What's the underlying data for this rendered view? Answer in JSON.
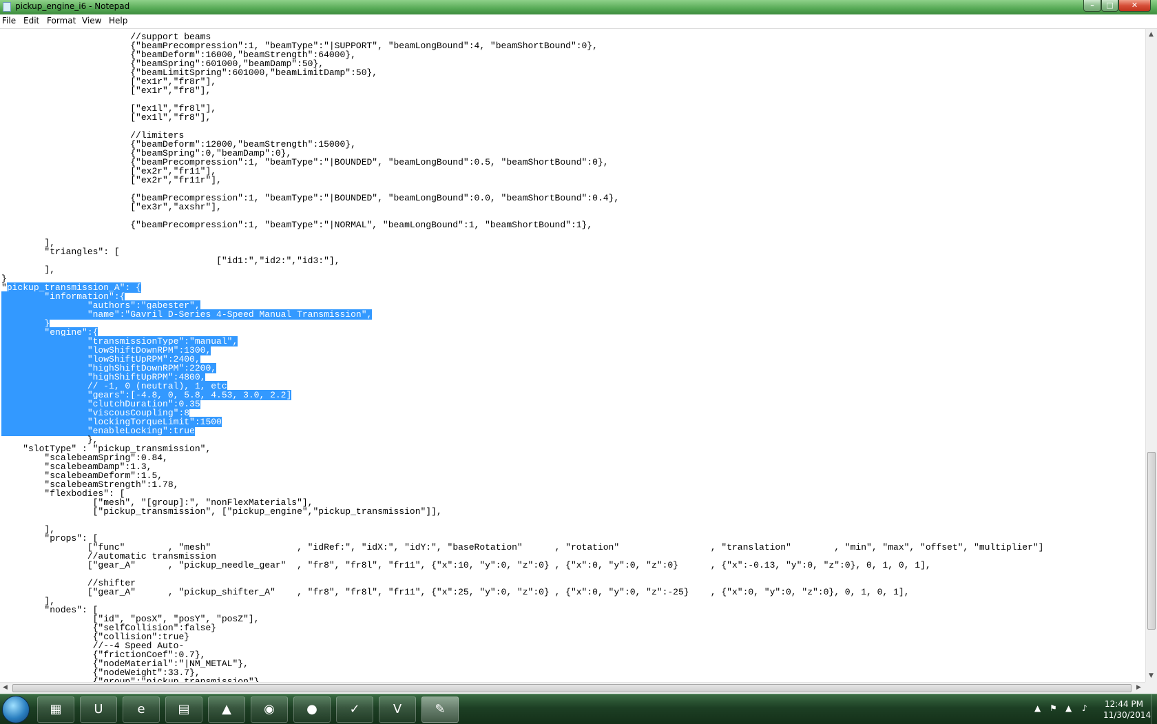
{
  "window": {
    "title": "pickup_engine_i6 - Notepad",
    "min_glyph": "–",
    "max_glyph": "□",
    "close_glyph": "✕"
  },
  "menu": [
    "File",
    "Edit",
    "Format",
    "View",
    "Help"
  ],
  "editor": {
    "lines": [
      {
        "pre": "\t\t\t//support beams",
        "sel": "",
        "post": ""
      },
      {
        "pre": "\t\t\t{\"beamPrecompression\":1, \"beamType\":\"|SUPPORT\", \"beamLongBound\":4, \"beamShortBound\":0},",
        "sel": "",
        "post": ""
      },
      {
        "pre": "\t\t\t{\"beamDeform\":16000,\"beamStrength\":64000},",
        "sel": "",
        "post": ""
      },
      {
        "pre": "\t\t\t{\"beamSpring\":601000,\"beamDamp\":50},",
        "sel": "",
        "post": ""
      },
      {
        "pre": "\t\t\t{\"beamLimitSpring\":601000,\"beamLimitDamp\":50},",
        "sel": "",
        "post": ""
      },
      {
        "pre": "\t\t\t[\"ex1r\",\"fr8r\"],",
        "sel": "",
        "post": ""
      },
      {
        "pre": "\t\t\t[\"ex1r\",\"fr8\"],",
        "sel": "",
        "post": ""
      },
      {
        "pre": "",
        "sel": "",
        "post": ""
      },
      {
        "pre": "\t\t\t[\"ex1l\",\"fr8l\"],",
        "sel": "",
        "post": ""
      },
      {
        "pre": "\t\t\t[\"ex1l\",\"fr8\"],",
        "sel": "",
        "post": ""
      },
      {
        "pre": "",
        "sel": "",
        "post": ""
      },
      {
        "pre": "\t\t\t//limiters",
        "sel": "",
        "post": ""
      },
      {
        "pre": "\t\t\t{\"beamDeform\":12000,\"beamStrength\":15000},",
        "sel": "",
        "post": ""
      },
      {
        "pre": "\t\t\t{\"beamSpring\":0,\"beamDamp\":0},",
        "sel": "",
        "post": ""
      },
      {
        "pre": "\t\t\t{\"beamPrecompression\":1, \"beamType\":\"|BOUNDED\", \"beamLongBound\":0.5, \"beamShortBound\":0},",
        "sel": "",
        "post": ""
      },
      {
        "pre": "\t\t\t[\"ex2r\",\"fr11\"],",
        "sel": "",
        "post": ""
      },
      {
        "pre": "\t\t\t[\"ex2r\",\"fr11r\"],",
        "sel": "",
        "post": ""
      },
      {
        "pre": "",
        "sel": "",
        "post": ""
      },
      {
        "pre": "\t\t\t{\"beamPrecompression\":1, \"beamType\":\"|BOUNDED\", \"beamLongBound\":0.0, \"beamShortBound\":0.4},",
        "sel": "",
        "post": ""
      },
      {
        "pre": "\t\t\t[\"ex3r\",\"axshr\"],",
        "sel": "",
        "post": ""
      },
      {
        "pre": "",
        "sel": "",
        "post": ""
      },
      {
        "pre": "\t\t\t{\"beamPrecompression\":1, \"beamType\":\"|NORMAL\", \"beamLongBound\":1, \"beamShortBound\":1},",
        "sel": "",
        "post": ""
      },
      {
        "pre": "",
        "sel": "",
        "post": ""
      },
      {
        "pre": "\t],",
        "sel": "",
        "post": ""
      },
      {
        "pre": "\t\"triangles\": [",
        "sel": "",
        "post": ""
      },
      {
        "pre": "\t\t\t\t\t[\"id1:\",\"id2:\",\"id3:\"],",
        "sel": "",
        "post": ""
      },
      {
        "pre": "\t],",
        "sel": "",
        "post": ""
      },
      {
        "pre": "}",
        "sel": "",
        "post": ""
      },
      {
        "pre": "\"",
        "sel": "pickup_transmission_A\": {",
        "post": ""
      },
      {
        "pre": "",
        "sel": "\t\"information\":{",
        "post": ""
      },
      {
        "pre": "",
        "sel": "\t\t\"authors\":\"gabester\",",
        "post": ""
      },
      {
        "pre": "",
        "sel": "\t\t\"name\":\"Gavril D-Series 4-Speed Manual Transmission\",",
        "post": ""
      },
      {
        "pre": "",
        "sel": "\t}",
        "post": ""
      },
      {
        "pre": "",
        "sel": "\t\"engine\":{",
        "post": ""
      },
      {
        "pre": "",
        "sel": "\t\t\"transmissionType\":\"manual\",",
        "post": ""
      },
      {
        "pre": "",
        "sel": "\t\t\"lowShiftDownRPM\":1300,",
        "post": ""
      },
      {
        "pre": "",
        "sel": "\t\t\"lowShiftUpRPM\":2400,",
        "post": ""
      },
      {
        "pre": "",
        "sel": "\t\t\"highShiftDownRPM\":2200,",
        "post": ""
      },
      {
        "pre": "",
        "sel": "\t\t\"highShiftUpRPM\":4800,",
        "post": ""
      },
      {
        "pre": "",
        "sel": "\t\t// -1, 0 (neutral), 1, etc",
        "post": ""
      },
      {
        "pre": "",
        "sel": "\t\t\"gears\":[-4.8, 0, 5.8, 4.53, 3.0, 2.2]",
        "post": ""
      },
      {
        "pre": "",
        "sel": "\t\t\"clutchDuration\":0.35",
        "post": ""
      },
      {
        "pre": "",
        "sel": "\t\t\"viscousCoupling\":8",
        "post": ""
      },
      {
        "pre": "",
        "sel": "\t\t\"lockingTorqueLimit\":1500",
        "post": ""
      },
      {
        "pre": "",
        "sel": "\t\t\"enableLocking\":true",
        "post": ""
      },
      {
        "pre": "\t\t},",
        "sel": "",
        "post": ""
      },
      {
        "pre": "    \"slotType\" : \"pickup_transmission\",",
        "sel": "",
        "post": ""
      },
      {
        "pre": "\t\"scalebeamSpring\":0.84,",
        "sel": "",
        "post": ""
      },
      {
        "pre": "\t\"scalebeamDamp\":1.3,",
        "sel": "",
        "post": ""
      },
      {
        "pre": "\t\"scalebeamDeform\":1.5,",
        "sel": "",
        "post": ""
      },
      {
        "pre": "\t\"scalebeamStrength\":1.78,",
        "sel": "",
        "post": ""
      },
      {
        "pre": "\t\"flexbodies\": [",
        "sel": "",
        "post": ""
      },
      {
        "pre": "\t\t [\"mesh\", \"[group]:\", \"nonFlexMaterials\"],",
        "sel": "",
        "post": ""
      },
      {
        "pre": "\t\t [\"pickup_transmission\", [\"pickup_engine\",\"pickup_transmission\"]],",
        "sel": "",
        "post": ""
      },
      {
        "pre": "",
        "sel": "",
        "post": ""
      },
      {
        "pre": "\t],",
        "sel": "",
        "post": ""
      },
      {
        "pre": "\t\"props\": [",
        "sel": "",
        "post": ""
      },
      {
        "pre": "\t\t[\"func\"        , \"mesh\"                , \"idRef:\", \"idX:\", \"idY:\", \"baseRotation\"      , \"rotation\"                 , \"translation\"        , \"min\", \"max\", \"offset\", \"multiplier\"]",
        "sel": "",
        "post": ""
      },
      {
        "pre": "\t\t//automatic transmission",
        "sel": "",
        "post": ""
      },
      {
        "pre": "\t\t[\"gear_A\"      , \"pickup_needle_gear\"  , \"fr8\", \"fr8l\", \"fr11\", {\"x\":10, \"y\":0, \"z\":0} , {\"x\":0, \"y\":0, \"z\":0}      , {\"x\":-0.13, \"y\":0, \"z\":0}, 0, 1, 0, 1],",
        "sel": "",
        "post": ""
      },
      {
        "pre": "",
        "sel": "",
        "post": ""
      },
      {
        "pre": "\t\t//shifter",
        "sel": "",
        "post": ""
      },
      {
        "pre": "\t\t[\"gear_A\"      , \"pickup_shifter_A\"    , \"fr8\", \"fr8l\", \"fr11\", {\"x\":25, \"y\":0, \"z\":0} , {\"x\":0, \"y\":0, \"z\":-25}    , {\"x\":0, \"y\":0, \"z\":0}, 0, 1, 0, 1],",
        "sel": "",
        "post": ""
      },
      {
        "pre": "\t],",
        "sel": "",
        "post": ""
      },
      {
        "pre": "\t\"nodes\": [",
        "sel": "",
        "post": ""
      },
      {
        "pre": "\t\t [\"id\", \"posX\", \"posY\", \"posZ\"],",
        "sel": "",
        "post": ""
      },
      {
        "pre": "\t\t {\"selfCollision\":false}",
        "sel": "",
        "post": ""
      },
      {
        "pre": "\t\t {\"collision\":true}",
        "sel": "",
        "post": ""
      },
      {
        "pre": "\t\t //--4 Speed Auto-",
        "sel": "",
        "post": ""
      },
      {
        "pre": "\t\t {\"frictionCoef\":0.7},",
        "sel": "",
        "post": ""
      },
      {
        "pre": "\t\t {\"nodeMaterial\":\"|NM_METAL\"},",
        "sel": "",
        "post": ""
      },
      {
        "pre": "\t\t {\"nodeWeight\":33.7},",
        "sel": "",
        "post": ""
      },
      {
        "pre": "\t\t {\"group\":\"pickup_transmission\"},",
        "sel": "",
        "post": ""
      }
    ]
  },
  "taskbar": {
    "apps": [
      {
        "name": "media-center",
        "glyph": "▦"
      },
      {
        "name": "uplay",
        "glyph": "U"
      },
      {
        "name": "internet-explorer",
        "glyph": "e"
      },
      {
        "name": "file-explorer",
        "glyph": "▤"
      },
      {
        "name": "vlc",
        "glyph": "▲"
      },
      {
        "name": "chrome",
        "glyph": "◉"
      },
      {
        "name": "steam",
        "glyph": "●"
      },
      {
        "name": "norton",
        "glyph": "✓"
      },
      {
        "name": "vim",
        "glyph": "V"
      },
      {
        "name": "notepad",
        "glyph": "✎"
      }
    ],
    "clock_time": "12:44 PM",
    "clock_date": "11/30/2014"
  },
  "colors": {
    "selection": "#3399ff",
    "titlebar": "#56a955",
    "taskbar": "#1d3f24"
  }
}
